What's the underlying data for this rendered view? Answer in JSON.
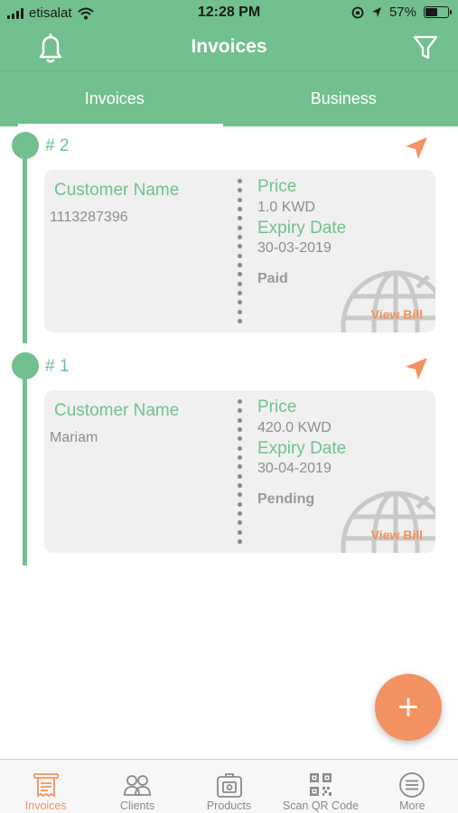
{
  "status_bar": {
    "carrier": "etisalat",
    "time": "12:28 PM",
    "battery": "57%",
    "battery_level": 0.57
  },
  "nav": {
    "title": "Invoices",
    "left_icon": "bell-icon",
    "right_icon": "filter-icon"
  },
  "tabs": [
    {
      "label": "Invoices",
      "active": true
    },
    {
      "label": "Business",
      "active": false
    }
  ],
  "invoices": [
    {
      "number": "# 2",
      "customer_label": "Customer Name",
      "customer_value": "1113287396",
      "price_label": "Price",
      "price_value": "1.0 KWD",
      "expiry_label": "Expiry Date",
      "expiry_value": "30-03-2019",
      "status": "Paid",
      "action": "View Bill"
    },
    {
      "number": "# 1",
      "customer_label": "Customer Name",
      "customer_value": "Mariam",
      "price_label": "Price",
      "price_value": "420.0 KWD",
      "expiry_label": "Expiry Date",
      "expiry_value": "30-04-2019",
      "status": "Pending",
      "action": "View Bill"
    }
  ],
  "fab": {
    "label": "+"
  },
  "bottom_tabs": [
    {
      "label": "Invoices",
      "icon": "invoice-icon",
      "active": true
    },
    {
      "label": "Clients",
      "icon": "clients-icon",
      "active": false
    },
    {
      "label": "Products",
      "icon": "products-icon",
      "active": false
    },
    {
      "label": "Scan QR Code",
      "icon": "qr-code-icon",
      "active": false
    },
    {
      "label": "More",
      "icon": "more-icon",
      "active": false
    }
  ],
  "colors": {
    "primary": "#72c08f",
    "accent": "#f39262",
    "card": "#f0f0f0"
  }
}
